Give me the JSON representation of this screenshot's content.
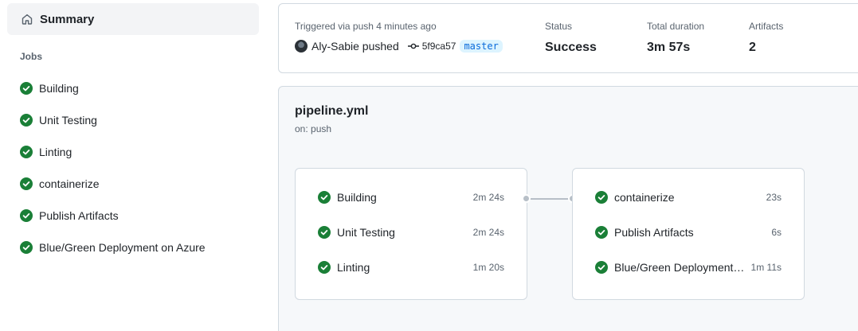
{
  "sidebar": {
    "summary_label": "Summary",
    "jobs_heading": "Jobs",
    "jobs": [
      {
        "label": "Building",
        "status": "success"
      },
      {
        "label": "Unit Testing",
        "status": "success"
      },
      {
        "label": "Linting",
        "status": "success"
      },
      {
        "label": "containerize",
        "status": "success"
      },
      {
        "label": "Publish Artifacts",
        "status": "success"
      },
      {
        "label": "Blue/Green Deployment on Azure",
        "status": "success"
      }
    ]
  },
  "run": {
    "trigger_label": "Triggered via push 4 minutes ago",
    "actor_text": "Aly-Sabie pushed",
    "commit_sha": "5f9ca57",
    "branch": "master",
    "status_label": "Status",
    "status_value": "Success",
    "duration_label": "Total duration",
    "duration_value": "3m 57s",
    "artifacts_label": "Artifacts",
    "artifacts_value": "2"
  },
  "workflow": {
    "file_name": "pipeline.yml",
    "trigger": "on: push",
    "stages": [
      {
        "jobs": [
          {
            "name": "Building",
            "duration": "2m 24s"
          },
          {
            "name": "Unit Testing",
            "duration": "2m 24s"
          },
          {
            "name": "Linting",
            "duration": "1m 20s"
          }
        ]
      },
      {
        "jobs": [
          {
            "name": "containerize",
            "duration": "23s"
          },
          {
            "name": "Publish Artifacts",
            "duration": "6s"
          },
          {
            "name": "Blue/Green Deployment on Azure",
            "duration": "1m 11s"
          }
        ]
      }
    ]
  },
  "colors": {
    "success": "#1a7f37",
    "link": "#0969da",
    "muted": "#59636e"
  }
}
